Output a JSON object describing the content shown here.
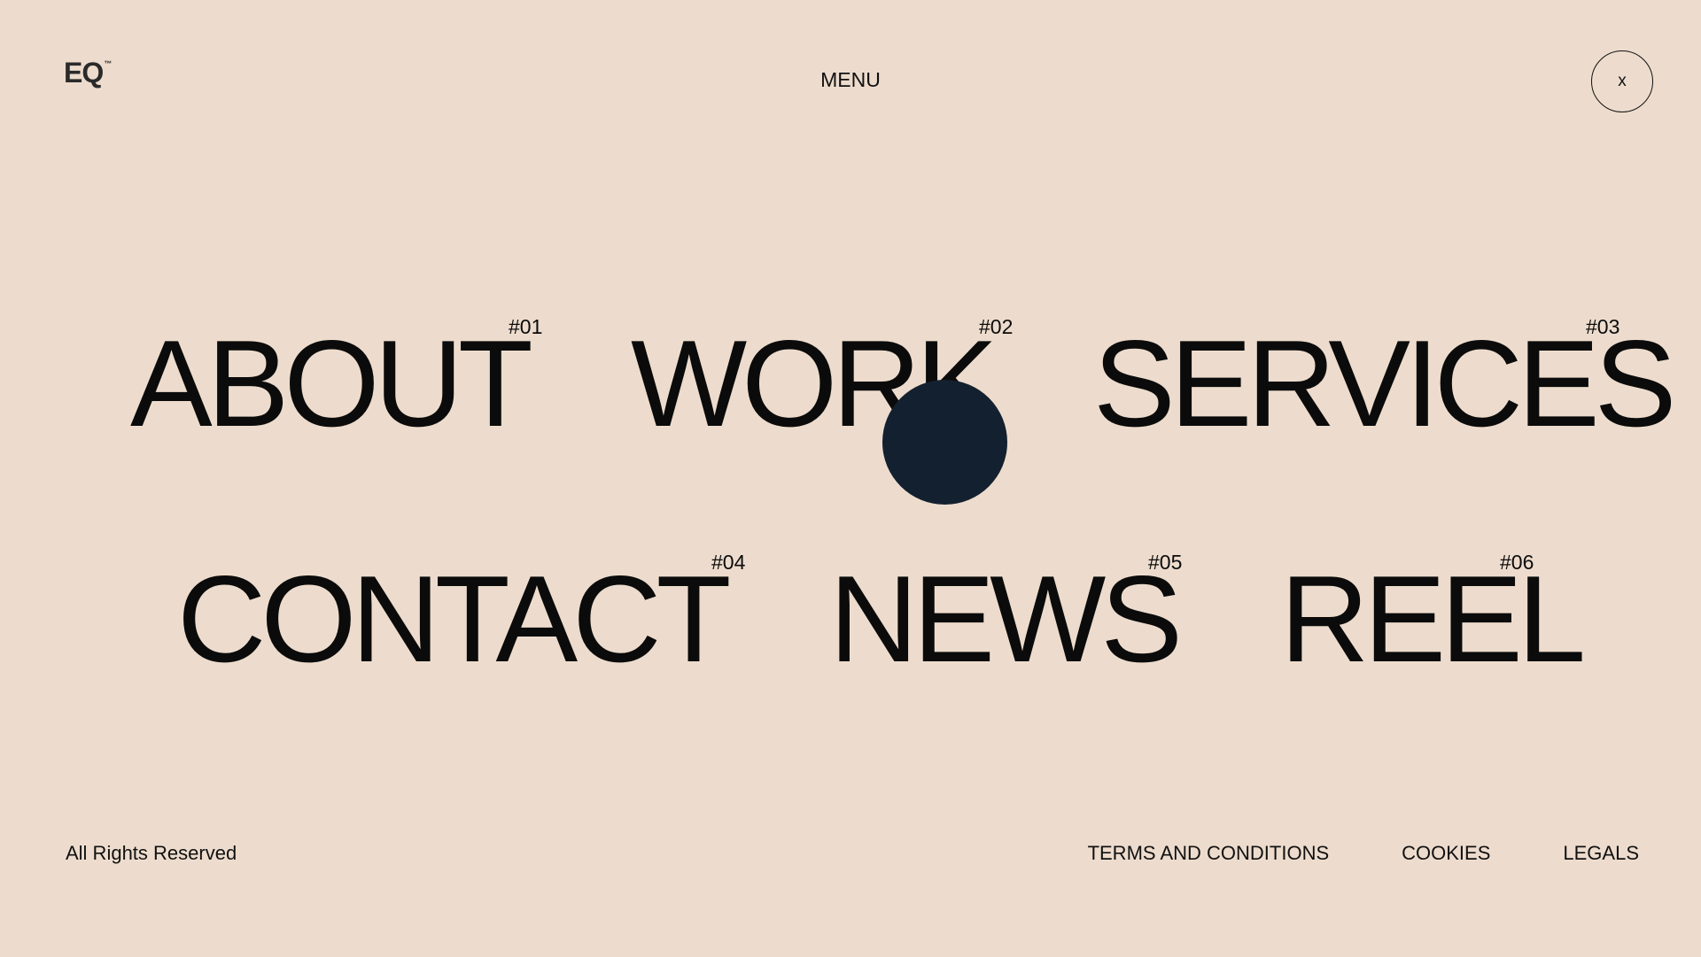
{
  "header": {
    "logo_text": "EQ",
    "logo_mark": "™",
    "menu_title": "MENU",
    "close_label": "x"
  },
  "nav": {
    "items": [
      {
        "label": "ABOUT",
        "number": "#01"
      },
      {
        "label": "WORK",
        "number": "#02"
      },
      {
        "label": "SERVICES",
        "number": "#03"
      },
      {
        "label": "CONTACT",
        "number": "#04"
      },
      {
        "label": "NEWS",
        "number": "#05"
      },
      {
        "label": "REEL",
        "number": "#06"
      }
    ]
  },
  "footer": {
    "rights": "All Rights Reserved",
    "links": [
      "TERMS AND CONDITIONS",
      "COOKIES",
      "LEGALS"
    ]
  },
  "colors": {
    "background": "#eddccd",
    "text": "#0b0b0b",
    "cursor_dot": "#13202f"
  }
}
